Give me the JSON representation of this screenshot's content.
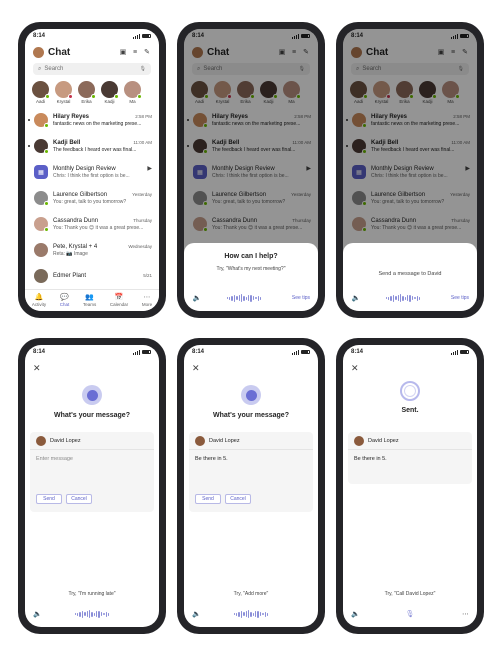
{
  "status_time": "8:14",
  "chat_list": {
    "title": "Chat",
    "search_placeholder": "Search",
    "contacts": [
      {
        "name": "Aadi",
        "color": "#6b5140",
        "presence": "#6bb700"
      },
      {
        "name": "Krystal",
        "color": "#c79a80",
        "presence": "#c4314b"
      },
      {
        "name": "Erika",
        "color": "#8c6a5a",
        "presence": "#6bb700"
      },
      {
        "name": "Kadji",
        "color": "#4a3a34",
        "presence": "#6bb700"
      },
      {
        "name": "Ma",
        "color": "#b89080",
        "presence": "#6bb700"
      }
    ],
    "chats": [
      {
        "name": "Hilary Reyes",
        "time": "2:58 PM",
        "preview": "fantastic news on the marketing prese...",
        "unread": true,
        "color": "#c98a5c",
        "presence": "#6bb700"
      },
      {
        "name": "Kadji Bell",
        "time": "11:00 AM",
        "preview": "The feedback I heard over was final...",
        "unread": true,
        "color": "#4a3a34",
        "presence": "#6bb700"
      },
      {
        "name": "Monthly Design Review",
        "time": "",
        "preview": "Chris: I think the first option is be...",
        "unread": false,
        "meeting": true
      },
      {
        "name": "Laurence Gilbertson",
        "time": "Yesterday",
        "preview": "You: great, talk to you tomorrow?",
        "unread": false,
        "color": "#8c8c8c",
        "presence": "#6bb700"
      },
      {
        "name": "Cassandra Dunn",
        "time": "Thursday",
        "preview": "You: Thank you 😊 it was a great prese...",
        "unread": false,
        "color": "#c9a08e",
        "presence": "#6bb700"
      },
      {
        "name": "Pete, Krystal + 4",
        "time": "Wednesday",
        "preview": "Reta: 📷 Image",
        "unread": false,
        "color": "#9a7a6a",
        "presence": ""
      },
      {
        "name": "Edmer Plant",
        "time": "5/21",
        "preview": "",
        "unread": false,
        "color": "#7a6a5a",
        "presence": ""
      }
    ],
    "tabs": [
      {
        "label": "Activity",
        "icon": "🔔"
      },
      {
        "label": "Chat",
        "icon": "💬"
      },
      {
        "label": "Teams",
        "icon": "👥"
      },
      {
        "label": "Calendar",
        "icon": "📅"
      },
      {
        "label": "More",
        "icon": "⋯"
      }
    ]
  },
  "voice": {
    "prompt": "How can I help?",
    "try_next_meeting": "Try, \"What's my next meeting?\"",
    "see_tips": "See tips",
    "send_message_to": "Send a message to David",
    "whats_your_message": "What's your message?",
    "recipient": "David Lopez",
    "enter_placeholder": "Enter message",
    "message_text": "Be there in 5.",
    "send": "Send",
    "cancel": "Cancel",
    "try_running_late": "Try, \"I'm running late\"",
    "try_add_more": "Try, \"Add more\"",
    "sent": "Sent.",
    "try_call_david": "Try, \"Call David Lopez\""
  },
  "colors": {
    "accent": "#5b5fc7",
    "available": "#6bb700",
    "busy": "#c4314b"
  }
}
